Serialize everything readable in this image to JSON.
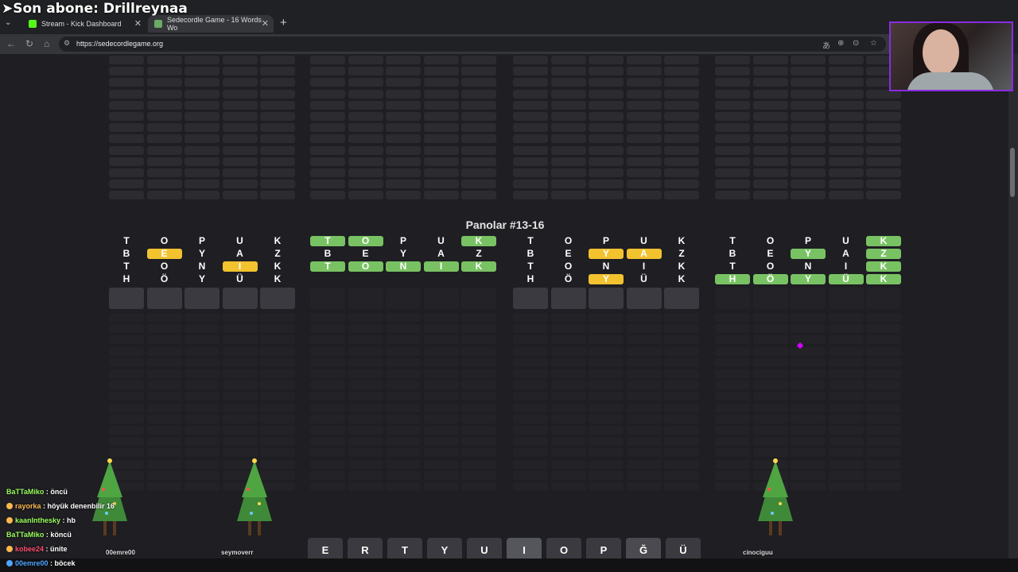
{
  "overlay": {
    "title": "➤Son abone: Drillreynaa"
  },
  "browser": {
    "tabs": [
      {
        "label": "Stream - Kick Dashboard",
        "color": "#53fc18"
      },
      {
        "label": "Sedecordle Game - 16 Words Wo",
        "color": "#6aaa64"
      }
    ],
    "url": "https://sedecordlegame.org"
  },
  "game": {
    "section_title": "Panolar #13-16",
    "colors": {
      "green": "#79c263",
      "yellow": "#f2c22f",
      "empty": "#2b2b30",
      "dim": "#232327"
    },
    "boards": [
      {
        "rows": [
          {
            "letters": [
              "T",
              "O",
              "P",
              "U",
              "K"
            ],
            "states": [
              "n",
              "n",
              "n",
              "n",
              "n"
            ]
          },
          {
            "letters": [
              "B",
              "E",
              "Y",
              "A",
              "Z"
            ],
            "states": [
              "n",
              "y",
              "n",
              "n",
              "n"
            ]
          },
          {
            "letters": [
              "T",
              "O",
              "N",
              "I",
              "K"
            ],
            "states": [
              "n",
              "n",
              "n",
              "y",
              "n"
            ]
          },
          {
            "letters": [
              "H",
              "Ö",
              "Y",
              "Ü",
              "K"
            ],
            "states": [
              "n",
              "n",
              "n",
              "n",
              "n"
            ]
          }
        ]
      },
      {
        "rows": [
          {
            "letters": [
              "T",
              "O",
              "P",
              "U",
              "K"
            ],
            "states": [
              "g",
              "g",
              "n",
              "n",
              "g"
            ]
          },
          {
            "letters": [
              "B",
              "E",
              "Y",
              "A",
              "Z"
            ],
            "states": [
              "n",
              "n",
              "n",
              "n",
              "n"
            ]
          },
          {
            "letters": [
              "T",
              "O",
              "N",
              "I",
              "K"
            ],
            "states": [
              "g",
              "g",
              "g",
              "g",
              "g"
            ]
          }
        ]
      },
      {
        "rows": [
          {
            "letters": [
              "T",
              "O",
              "P",
              "U",
              "K"
            ],
            "states": [
              "n",
              "n",
              "n",
              "n",
              "n"
            ]
          },
          {
            "letters": [
              "B",
              "E",
              "Y",
              "A",
              "Z"
            ],
            "states": [
              "n",
              "n",
              "y",
              "y",
              "n"
            ]
          },
          {
            "letters": [
              "T",
              "O",
              "N",
              "I",
              "K"
            ],
            "states": [
              "n",
              "n",
              "n",
              "n",
              "n"
            ]
          },
          {
            "letters": [
              "H",
              "Ö",
              "Y",
              "Ü",
              "K"
            ],
            "states": [
              "n",
              "n",
              "y",
              "n",
              "n"
            ]
          }
        ]
      },
      {
        "rows": [
          {
            "letters": [
              "T",
              "O",
              "P",
              "U",
              "K"
            ],
            "states": [
              "n",
              "n",
              "n",
              "n",
              "g"
            ]
          },
          {
            "letters": [
              "B",
              "E",
              "Y",
              "A",
              "Z"
            ],
            "states": [
              "n",
              "n",
              "g",
              "n",
              "g"
            ]
          },
          {
            "letters": [
              "T",
              "O",
              "N",
              "I",
              "K"
            ],
            "states": [
              "n",
              "n",
              "n",
              "n",
              "g"
            ]
          },
          {
            "letters": [
              "H",
              "Ö",
              "Y",
              "Ü",
              "K"
            ],
            "states": [
              "g",
              "g",
              "g",
              "g",
              "g"
            ]
          }
        ]
      }
    ],
    "keyboard": [
      "E",
      "R",
      "T",
      "Y",
      "U",
      "I",
      "O",
      "P",
      "Ğ",
      "Ü"
    ]
  },
  "chat": [
    {
      "user": "BaTTaMiko",
      "color": "#9bff5a",
      "message": "öncü"
    },
    {
      "user": "rayorka",
      "color": "#ffb84d",
      "message": "höyük denenbilir 16"
    },
    {
      "user": "kaanInthesky",
      "color": "#9bff5a",
      "message": "hb"
    },
    {
      "user": "BaTTaMiko",
      "color": "#9bff5a",
      "message": "köncü"
    },
    {
      "user": "kobee24",
      "color": "#ff4d6d",
      "message": "ünite"
    },
    {
      "user": "00emre00",
      "color": "#4da6ff",
      "message": "böcek"
    }
  ],
  "stream_usernames": [
    "00emre00",
    "seymoverr",
    "cinociguu"
  ]
}
